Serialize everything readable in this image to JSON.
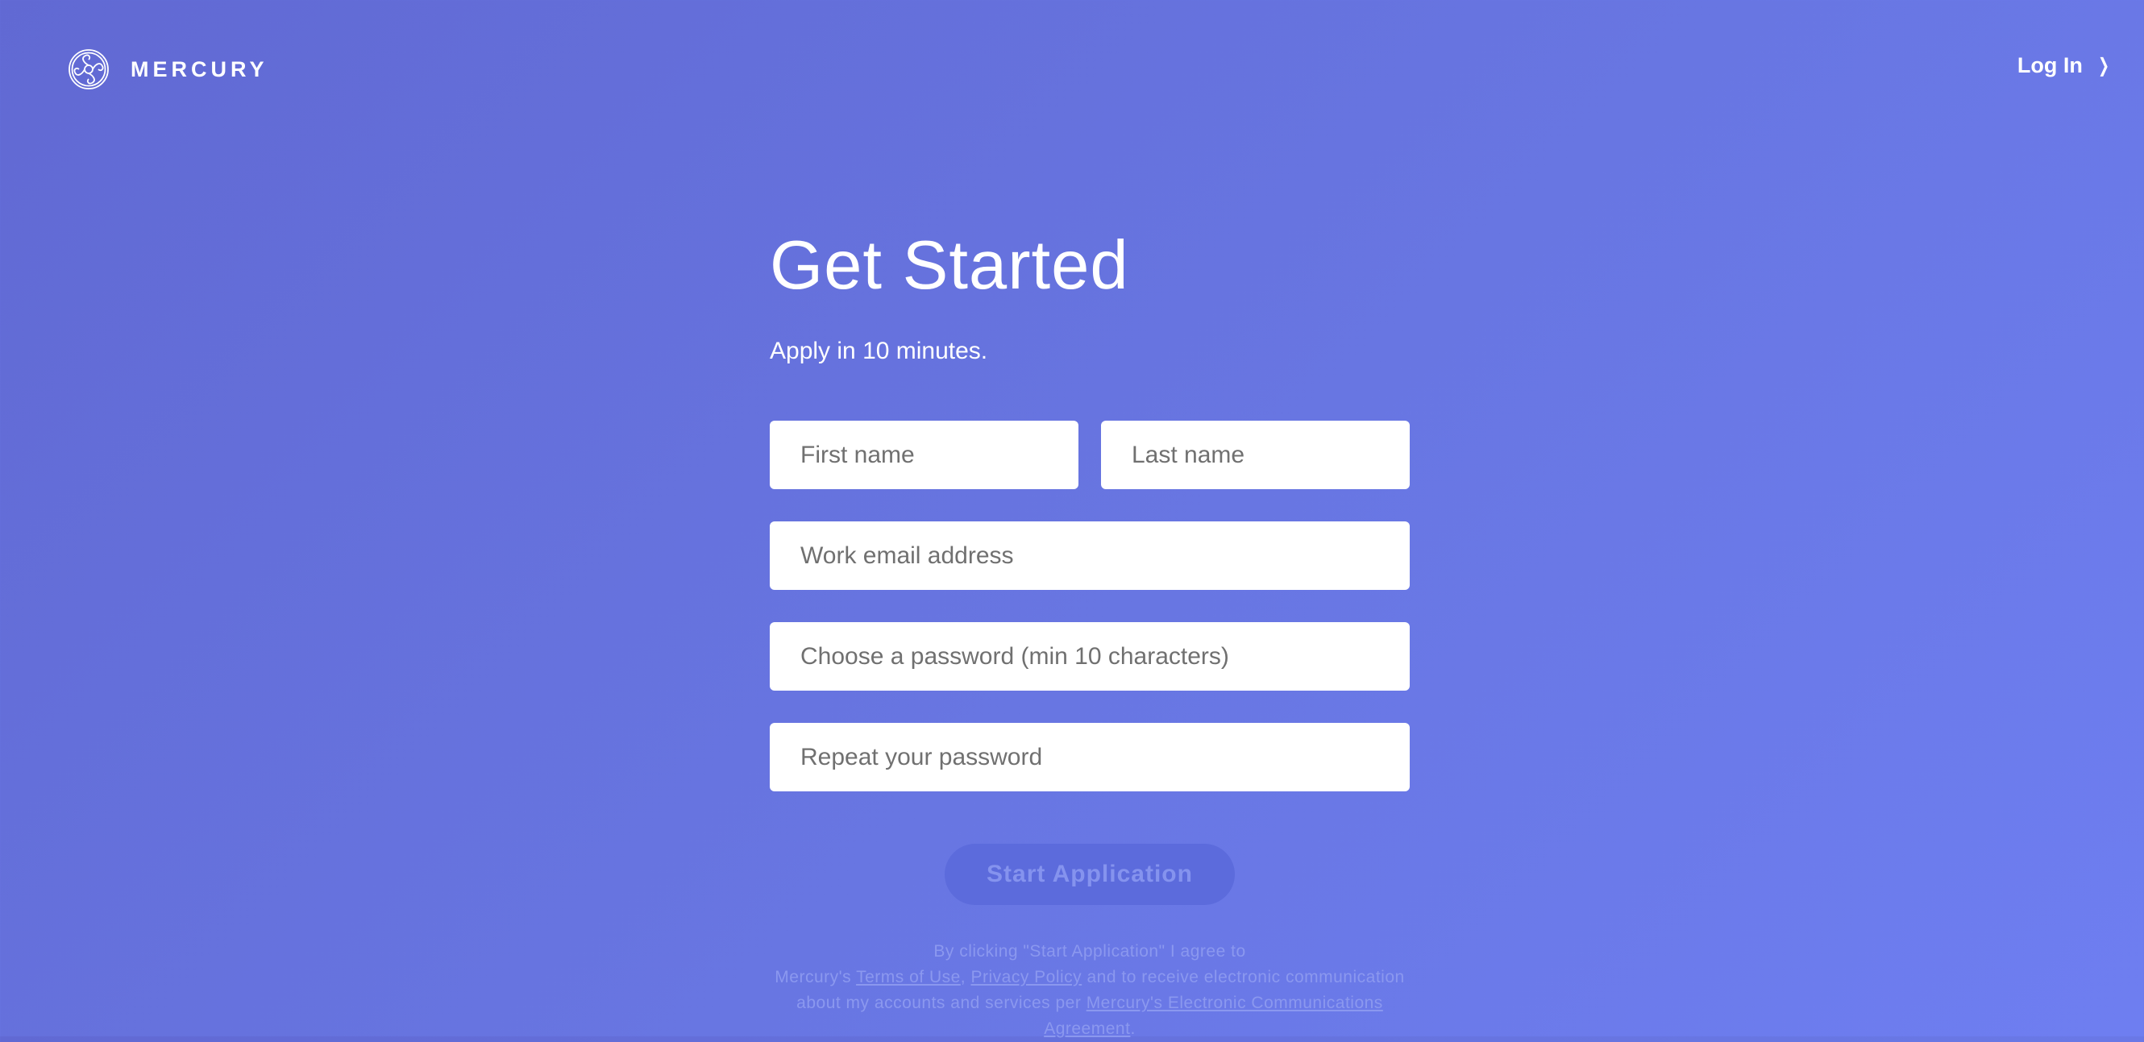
{
  "header": {
    "brand": "MERCURY",
    "login_label": "Log In",
    "login_icon": "chevron-right-icon"
  },
  "main": {
    "title": "Get Started",
    "subtitle": "Apply in 10 minutes.",
    "fields": {
      "first_name": {
        "placeholder": "First name",
        "value": ""
      },
      "last_name": {
        "placeholder": "Last name",
        "value": ""
      },
      "email": {
        "placeholder": "Work email address",
        "value": ""
      },
      "password": {
        "placeholder": "Choose a password (min 10 characters)",
        "value": ""
      },
      "repeat_password": {
        "placeholder": "Repeat your password",
        "value": ""
      }
    },
    "submit_label": "Start Application"
  },
  "legal": {
    "line1": "By clicking \"Start Application\" I agree to",
    "prefix": "Mercury's ",
    "terms_link": "Terms of Use",
    "comma": ", ",
    "privacy_link": "Privacy Policy",
    "mid": " and to receive electronic communication about my accounts and services per ",
    "agreement_link": "Mercury's Electronic Communications Agreement",
    "end": "."
  },
  "colors": {
    "bg_start": "#6169d3",
    "bg_end": "#6e7ef1",
    "button_bg": "#5c6bdc",
    "button_text": "#8593ee"
  }
}
